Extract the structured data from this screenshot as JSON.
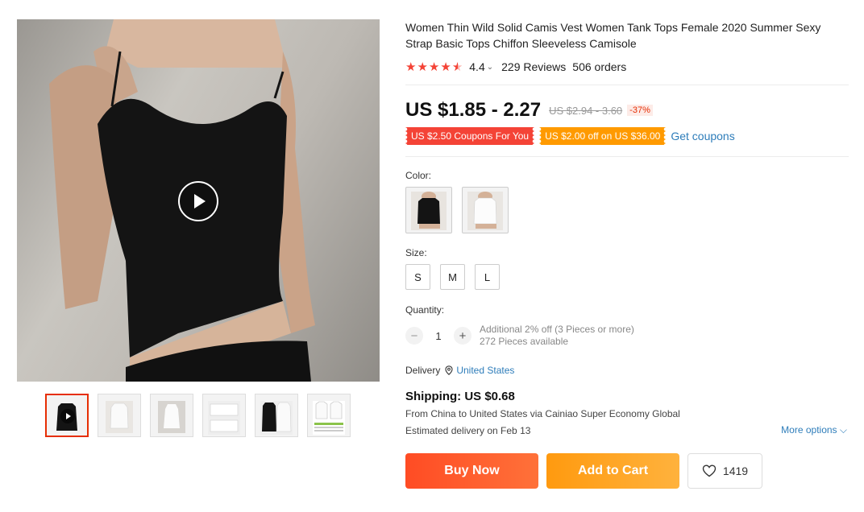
{
  "product": {
    "title": "Women Thin Wild Solid Camis Vest Women Tank Tops Female 2020 Summer Sexy Strap Basic Tops Chiffon Sleeveless Camisole",
    "rating": "4.4",
    "rating_stars": 4.5,
    "reviews": "229 Reviews",
    "orders": "506 orders"
  },
  "price": {
    "current": "US $1.85 - 2.27",
    "original": "US $2.94 - 3.60",
    "discount": "-37%"
  },
  "coupons": {
    "coupon_1": "US $2.50 Coupons For You",
    "coupon_2": "US $2.00 off on US $36.00",
    "get_coupons": "Get coupons"
  },
  "color": {
    "label": "Color:",
    "options": [
      {
        "icon": "black-camisole",
        "fill": "#111111"
      },
      {
        "icon": "white-camisole",
        "fill": "#ffffff"
      }
    ]
  },
  "size": {
    "label": "Size:",
    "options": [
      "S",
      "M",
      "L"
    ]
  },
  "quantity": {
    "label": "Quantity:",
    "value": "1",
    "info_line1": "Additional 2% off (3 Pieces or more)",
    "info_line2": "272 Pieces available"
  },
  "delivery": {
    "label": "Delivery",
    "destination": "United States"
  },
  "shipping": {
    "title": "Shipping: US $0.68",
    "route": "From China to United States via Cainiao Super Economy Global",
    "estimate": "Estimated delivery on Feb 13",
    "more_options": "More options"
  },
  "actions": {
    "buy_now": "Buy Now",
    "add_to_cart": "Add to Cart",
    "wishlist_count": "1419"
  },
  "colors": {
    "accent_red": "#e62e04",
    "star_red": "#f44336",
    "link_blue": "#2e7dba",
    "coupon_orange": "#ff9a00"
  }
}
